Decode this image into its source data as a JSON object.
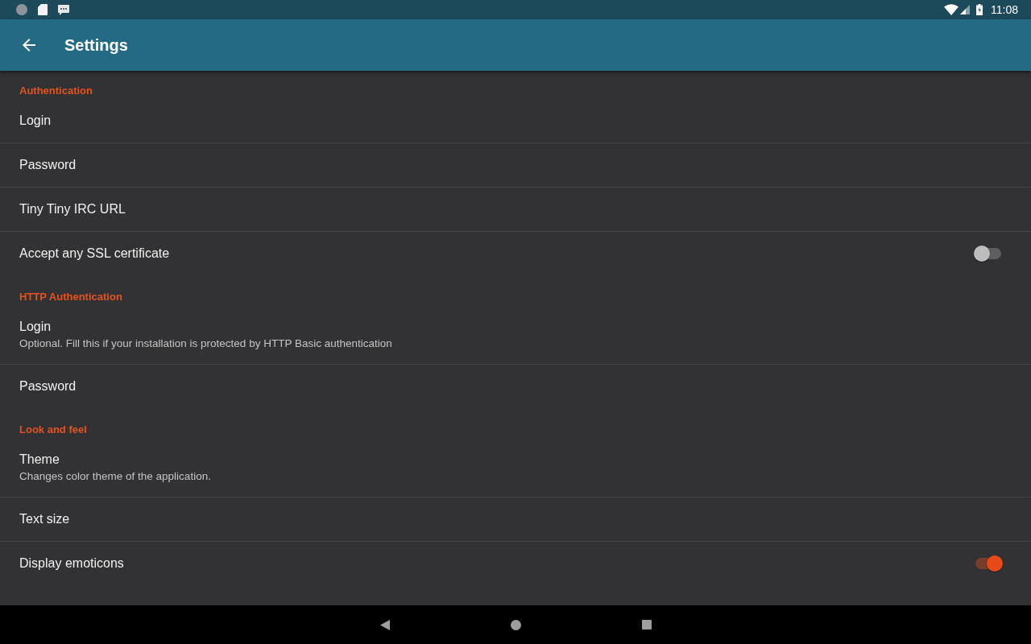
{
  "status_bar": {
    "time": "11:08"
  },
  "app_bar": {
    "title": "Settings"
  },
  "sections": [
    {
      "title": "Authentication",
      "items": [
        {
          "kind": "text",
          "title": "Login"
        },
        {
          "kind": "text",
          "title": "Password"
        },
        {
          "kind": "text",
          "title": "Tiny Tiny IRC URL"
        },
        {
          "kind": "switch",
          "title": "Accept any SSL certificate",
          "on": false
        }
      ]
    },
    {
      "title": "HTTP Authentication",
      "items": [
        {
          "kind": "text",
          "title": "Login",
          "summary": "Optional. Fill this if your installation is protected by HTTP Basic authentication"
        },
        {
          "kind": "text",
          "title": "Password"
        }
      ]
    },
    {
      "title": "Look and feel",
      "items": [
        {
          "kind": "text",
          "title": "Theme",
          "summary": "Changes color theme of the application."
        },
        {
          "kind": "text",
          "title": "Text size"
        },
        {
          "kind": "switch",
          "title": "Display emoticons",
          "on": true
        }
      ]
    }
  ]
}
